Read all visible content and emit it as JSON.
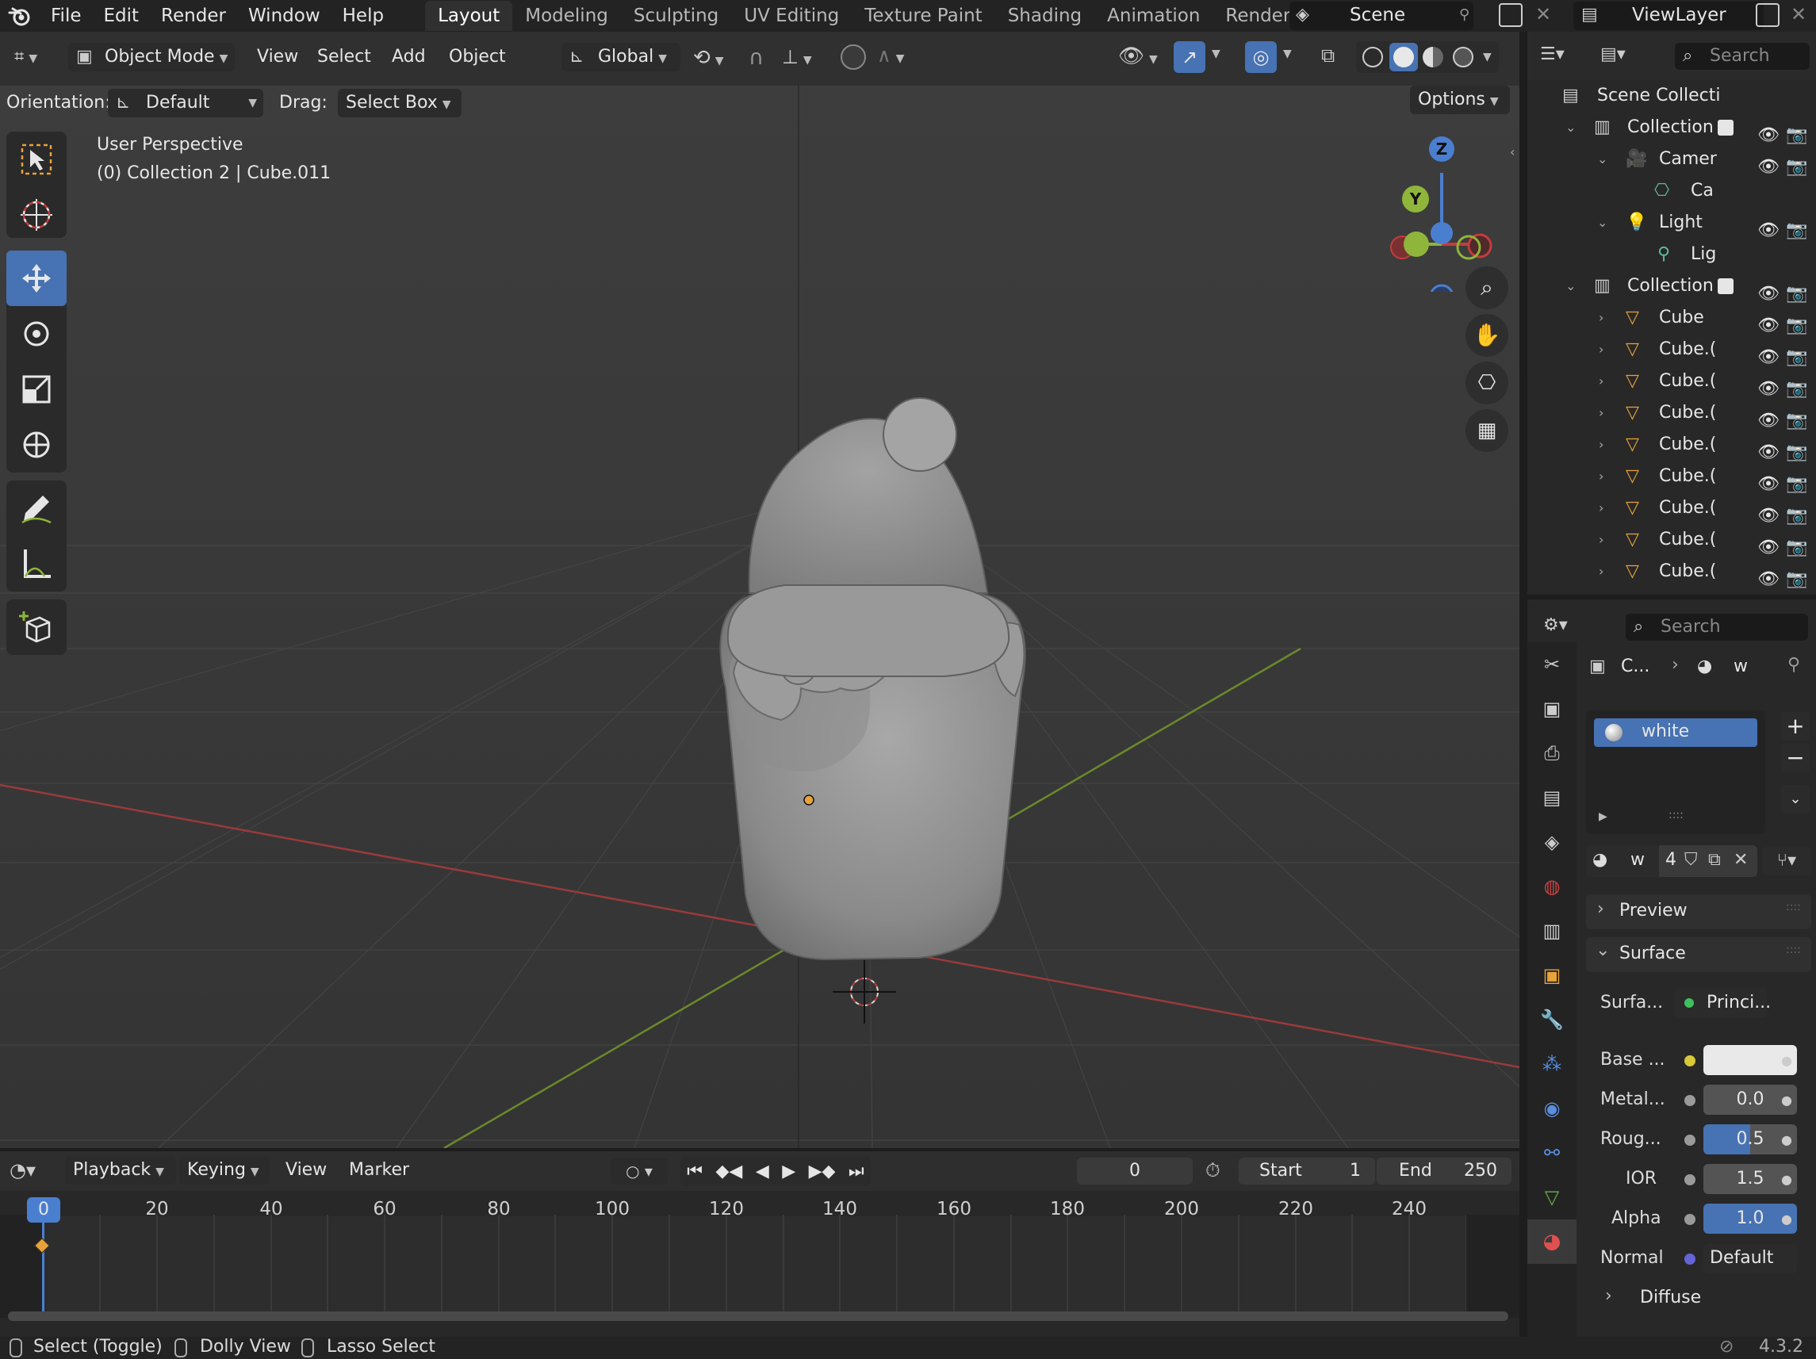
{
  "menu": {
    "file": "File",
    "edit": "Edit",
    "render": "Render",
    "window": "Window",
    "help": "Help"
  },
  "workspaces": [
    "Layout",
    "Modeling",
    "Sculpting",
    "UV Editing",
    "Texture Paint",
    "Shading",
    "Animation",
    "Rendering"
  ],
  "scene": {
    "name": "Scene"
  },
  "view_layer": {
    "name": "ViewLayer"
  },
  "header": {
    "mode": "Object Mode",
    "view": "View",
    "select": "Select",
    "add": "Add",
    "object": "Object",
    "transform_orientation": "Global",
    "orientation_label": "Orientation:",
    "orientation_value": "Default",
    "drag_label": "Drag:",
    "drag_value": "Select Box",
    "options": "Options"
  },
  "viewport": {
    "title": "User Perspective",
    "subtitle": "(0) Collection 2 | Cube.011"
  },
  "gizmo": {
    "z": "Z",
    "y": "Y"
  },
  "outliner": {
    "search_placeholder": "Search",
    "rows": [
      {
        "label": "Scene Collecti"
      },
      {
        "label": "Collection"
      },
      {
        "label": "Camer"
      },
      {
        "label": "Ca"
      },
      {
        "label": "Light"
      },
      {
        "label": "Lig"
      },
      {
        "label": "Collection"
      },
      {
        "label": "Cube"
      },
      {
        "label": "Cube.("
      },
      {
        "label": "Cube.("
      },
      {
        "label": "Cube.("
      },
      {
        "label": "Cube.("
      },
      {
        "label": "Cube.("
      },
      {
        "label": "Cube.("
      },
      {
        "label": "Cube.("
      },
      {
        "label": "Cube.("
      }
    ]
  },
  "properties": {
    "search_placeholder": "Search",
    "breadcrumb_object": "C...",
    "breadcrumb_material": "w",
    "material_slot": "white",
    "material_name": "w",
    "user_count": "4",
    "preview": "Preview",
    "surface": "Surface",
    "surface_label": "Surfa...",
    "surface_value": "Princi...",
    "base_color_label": "Base ...",
    "metallic_label": "Metal...",
    "metallic_value": "0.0",
    "roughness_label": "Roug...",
    "roughness_value": "0.5",
    "ior_label": "IOR",
    "ior_value": "1.5",
    "alpha_label": "Alpha",
    "alpha_value": "1.0",
    "normal_label": "Normal",
    "normal_value": "Default",
    "diffuse": "Diffuse"
  },
  "timeline": {
    "playback": "Playback",
    "keying": "Keying",
    "view": "View",
    "marker": "Marker",
    "current_frame": "0",
    "start_label": "Start",
    "start_value": "1",
    "end_label": "End",
    "end_value": "250",
    "ticks": [
      "0",
      "20",
      "40",
      "60",
      "80",
      "100",
      "120",
      "140",
      "160",
      "180",
      "200",
      "220",
      "240"
    ]
  },
  "status": {
    "select": "Select (Toggle)",
    "dolly": "Dolly View",
    "lasso": "Lasso Select",
    "version": "4.3.2"
  },
  "colors": {
    "accent": "#4772b3",
    "active_blue": "#4772b3",
    "x_axis": "#c43c3c",
    "y_axis": "#6a9a2a",
    "keyframe": "#e7a23a"
  }
}
